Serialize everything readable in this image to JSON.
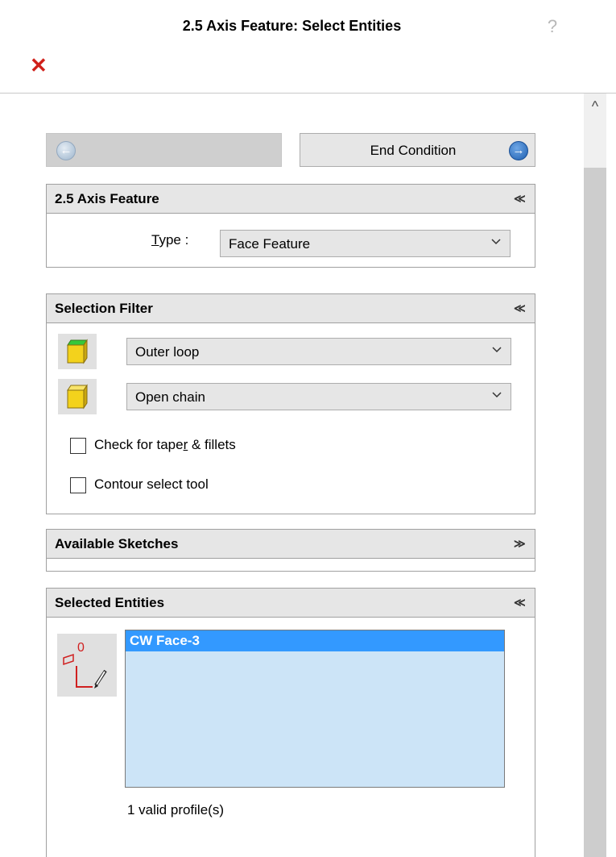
{
  "header": {
    "title": "2.5 Axis Feature: Select Entities",
    "help_glyph": "?",
    "close_glyph": "✕"
  },
  "nav": {
    "back_glyph": "←",
    "next_label": "End Condition",
    "next_glyph": "→"
  },
  "scrollbar": {
    "up_glyph": "^"
  },
  "feature_group": {
    "title": "2.5 Axis Feature",
    "collapse_glyph": "≪",
    "type_label_first": "T",
    "type_label_rest": "ype :",
    "type_value": "Face Feature"
  },
  "filter_group": {
    "title": "Selection Filter",
    "collapse_glyph": "≪",
    "loop_value": "Outer loop",
    "chain_value": "Open chain",
    "taper_label_a": "Check for tape",
    "taper_label_b": "r",
    "taper_label_c": " & fillets",
    "contour_label": "Contour select tool",
    "taper_checked": false,
    "contour_checked": false
  },
  "sketches_group": {
    "title": "Available Sketches",
    "expand_glyph": "≫"
  },
  "selected_group": {
    "title": "Selected Entities",
    "collapse_glyph": "≪",
    "items": [
      "CW Face-3"
    ],
    "valid_count": "1 valid profile(s)"
  },
  "colors": {
    "accent": "#3399ff",
    "listbox_bg": "#cce4f7",
    "close_red": "#d0201a"
  },
  "icons": {
    "loop_filter": "cube-green-top-icon",
    "chain_filter": "cube-yellow-icon",
    "entity_tool": "sketch-profile-pencil-icon"
  }
}
